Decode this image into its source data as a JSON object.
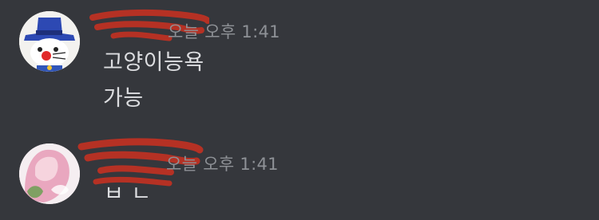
{
  "messages": [
    {
      "username": "",
      "timestamp": "오늘 오후 1:41",
      "lines": [
        "고양이능욕",
        "가능"
      ],
      "avatar": "cat-blue-hat-avatar"
    },
    {
      "username": "",
      "timestamp": "오늘 오후 1:41",
      "lines": [
        "ㅂ ㄴ"
      ],
      "avatar": "pink-hair-avatar"
    }
  ],
  "colors": {
    "background": "#35373c",
    "message_text": "#dcdde0",
    "timestamp": "#8e9196",
    "redaction": "#b53124"
  }
}
